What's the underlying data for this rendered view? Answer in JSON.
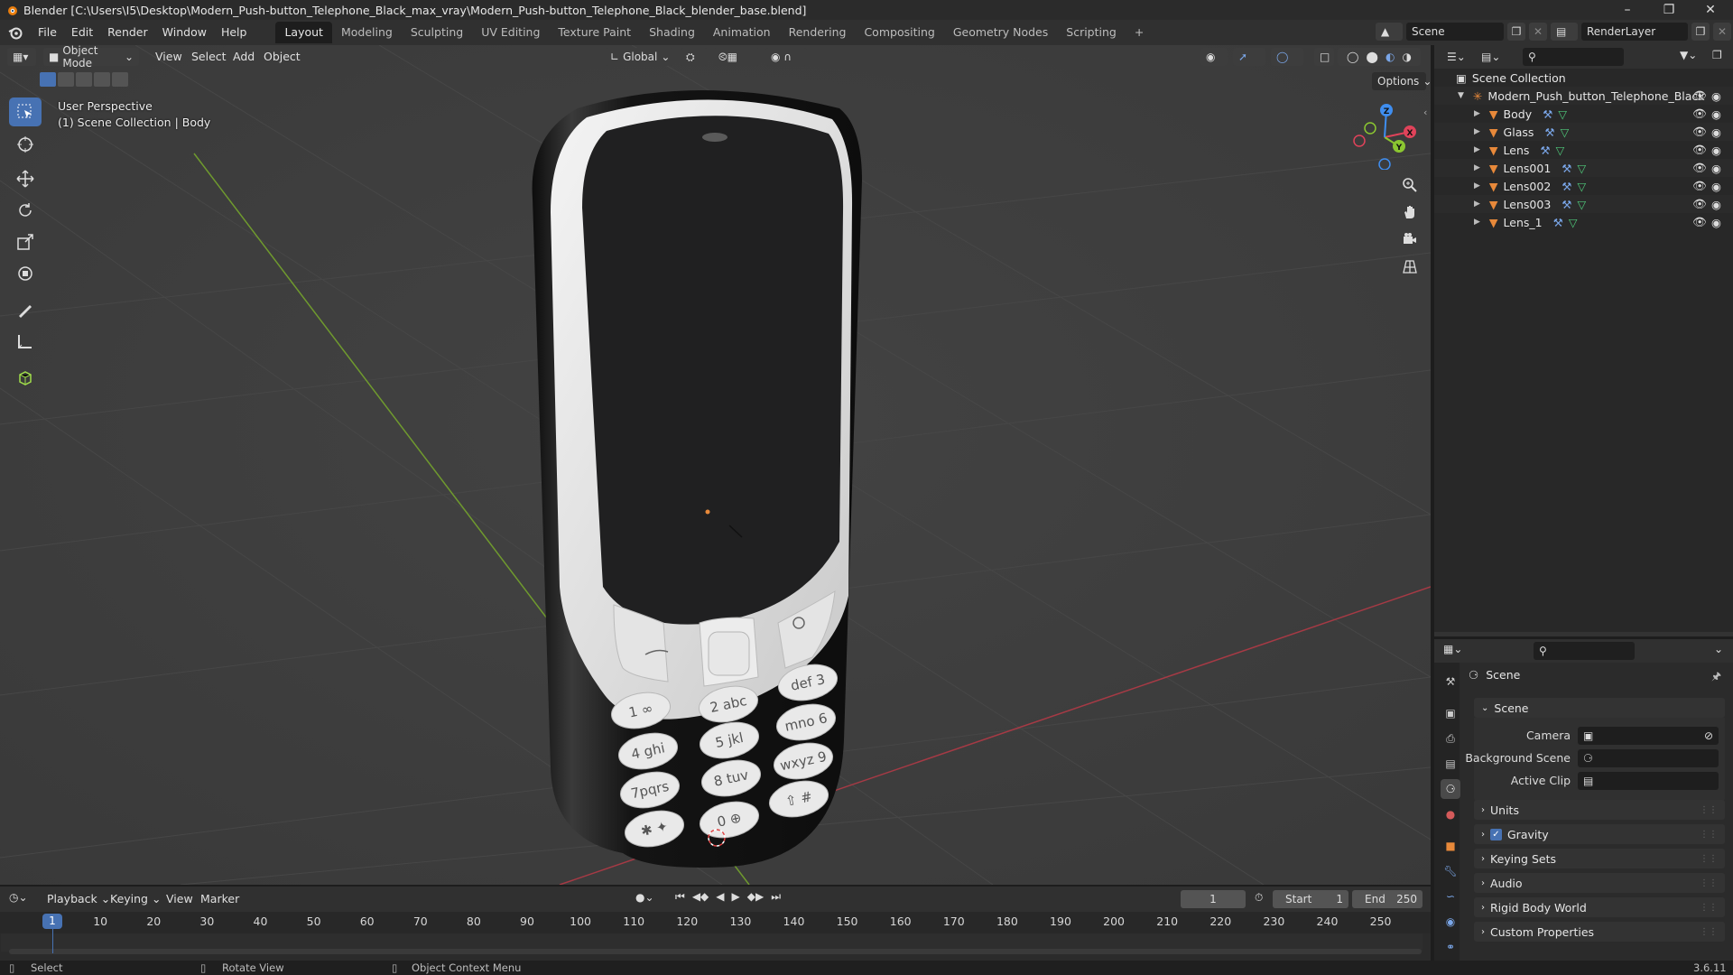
{
  "window": {
    "title": "Blender [C:\\Users\\I5\\Desktop\\Modern_Push-button_Telephone_Black_max_vray\\Modern_Push-button_Telephone_Black_blender_base.blend]",
    "controls": [
      "minimize",
      "restore",
      "close"
    ]
  },
  "menubar": {
    "menus": [
      "File",
      "Edit",
      "Render",
      "Window",
      "Help"
    ],
    "workspaces": [
      "Layout",
      "Modeling",
      "Sculpting",
      "UV Editing",
      "Texture Paint",
      "Shading",
      "Animation",
      "Rendering",
      "Compositing",
      "Geometry Nodes",
      "Scripting"
    ],
    "active_workspace": "Layout",
    "add_workspace": "+",
    "scene": "Scene",
    "view_layer": "RenderLayer"
  },
  "viewport": {
    "mode": "Object Mode",
    "menus": [
      "View",
      "Select",
      "Add",
      "Object"
    ],
    "orientation": "Global",
    "options_label": "Options",
    "overlay_line1": "User Perspective",
    "overlay_line2": "(1) Scene Collection | Body",
    "tools": [
      "select-box",
      "cursor",
      "move",
      "rotate",
      "scale",
      "transform",
      "annotate",
      "measure",
      "add-cube"
    ],
    "active_tool": "select-box",
    "gizmo_axes": {
      "x": "X",
      "y": "Y",
      "z": "Z"
    },
    "axis_colors": {
      "x": "#e0435a",
      "y": "#8bc631",
      "z": "#3f8ef0"
    },
    "phone_keys": [
      "1 ∞",
      "2 abc",
      "def 3",
      "4 ghi",
      "5 jkl",
      "mno 6",
      "7pqrs",
      "8 tuv",
      "wxyz 9",
      "✱ ✦",
      "0 ⊕",
      "⇧ #"
    ]
  },
  "outliner": {
    "root": "Scene Collection",
    "collection": "Modern_Push_button_Telephone_Black",
    "objects": [
      "Body",
      "Glass",
      "Lens",
      "Lens001",
      "Lens002",
      "Lens003",
      "Lens_1"
    ]
  },
  "properties": {
    "context": "Scene",
    "panel_title": "Scene",
    "fields": [
      {
        "label": "Camera",
        "value": ""
      },
      {
        "label": "Background Scene",
        "value": ""
      },
      {
        "label": "Active Clip",
        "value": ""
      }
    ],
    "collapsed_panels": [
      "Units",
      "Gravity",
      "Keying Sets",
      "Audio",
      "Rigid Body World",
      "Custom Properties"
    ],
    "gravity_checked": true
  },
  "timeline": {
    "menus": [
      "Playback",
      "Keying",
      "View",
      "Marker"
    ],
    "current_frame": "1",
    "start_label": "Start",
    "start": "1",
    "end_label": "End",
    "end": "250",
    "ticks": [
      "1",
      "10",
      "20",
      "30",
      "40",
      "50",
      "60",
      "70",
      "80",
      "90",
      "100",
      "110",
      "120",
      "130",
      "140",
      "150",
      "160",
      "170",
      "180",
      "190",
      "200",
      "210",
      "220",
      "230",
      "240",
      "250"
    ]
  },
  "statusbar": {
    "select": "Select",
    "rotate_view": "Rotate View",
    "context_menu": "Object Context Menu",
    "version": "3.6.11"
  },
  "colors": {
    "accent_blue": "#4772b3",
    "object_orange": "#e8893a",
    "mesh_green": "#4fc97a",
    "modifier_blue": "#7aa6e8"
  }
}
